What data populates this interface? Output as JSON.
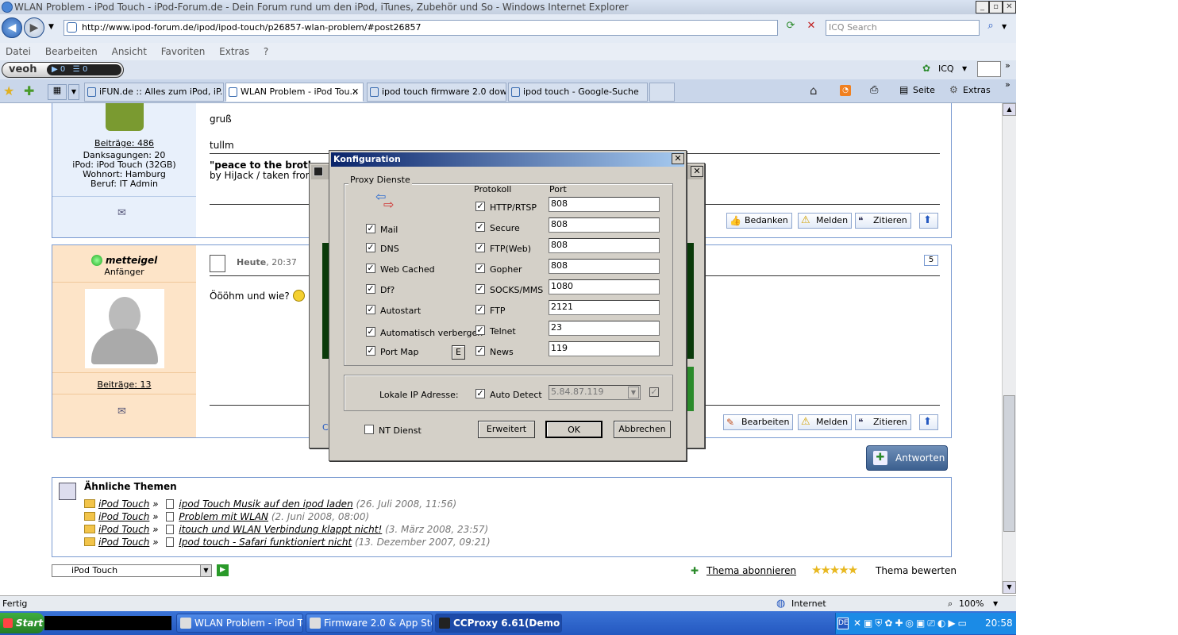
{
  "window": {
    "title": "WLAN Problem - iPod Touch - iPod-Forum.de - Dein Forum rund um den iPod, iTunes, Zubehör und So - Windows Internet Explorer"
  },
  "address": {
    "url": "http://www.ipod-forum.de/ipod/ipod-touch/p26857-wlan-problem/#post26857",
    "search_placeholder": "ICQ Search"
  },
  "menu": [
    "Datei",
    "Bearbeiten",
    "Ansicht",
    "Favoriten",
    "Extras",
    "?"
  ],
  "toolbar": {
    "veoh": "veoh",
    "icq": "ICQ",
    "counter1": "0",
    "counter2": "0"
  },
  "tabs": [
    "iFUN.de :: Alles zum iPod, iP...",
    "WLAN Problem - iPod Tou...",
    "ipod touch firmware 2.0 dow...",
    "ipod touch - Google-Suche"
  ],
  "cmdbar": {
    "seite": "Seite",
    "extras": "Extras"
  },
  "post1": {
    "beitraege": "Beiträge: 486",
    "danksagungen": "Danksagungen: 20",
    "ipod": "iPod: iPod Touch (32GB)",
    "wohnort": "Wohnort: Hamburg",
    "beruf": "Beruf: IT Admin",
    "line1": "gruß",
    "line2": "tullm",
    "quote": "\"peace to the broth",
    "quote2": "by HiJack / taken fron",
    "btn_thanks": "Bedanken",
    "btn_report": "Melden",
    "btn_quote": "Zitieren"
  },
  "post2": {
    "user": "metteigel",
    "rank": "Anfänger",
    "beitraege": "Beiträge: 13",
    "date": "Heute",
    "time": ", 20:37",
    "number": "5",
    "text": "Öööhm und wie?",
    "btn_edit": "Bearbeiten",
    "btn_report": "Melden",
    "btn_quote": "Zitieren"
  },
  "reply_btn": "Antworten",
  "similar": {
    "title": "Ähnliche Themen",
    "rows": [
      {
        "cat": "iPod Touch",
        "topic": "ipod Touch Musik auf den ipod laden",
        "date": "(26. Juli 2008, 11:56)"
      },
      {
        "cat": "iPod Touch",
        "topic": "Problem mit WLAN",
        "date": "(2. Juni 2008, 08:00)"
      },
      {
        "cat": "iPod Touch",
        "topic": "itouch und WLAN Verbindung klappt nicht!",
        "date": "(3. März 2008, 23:57)"
      },
      {
        "cat": "iPod Touch",
        "topic": "Ipod touch - Safari funktioniert nicht",
        "date": "(13. Dezember 2007, 09:21)"
      }
    ]
  },
  "footer": {
    "select": "iPod Touch",
    "subscribe": "Thema abonnieren",
    "rate": "Thema bewerten"
  },
  "status": {
    "text": "Fertig",
    "zone": "Internet",
    "zoom": "100%"
  },
  "taskbar": {
    "start": "Start",
    "items": [
      "WLAN Problem - iPod To...",
      "Firmware 2.0 & App Stor...",
      "CCProxy 6.61(Demo v..."
    ],
    "clock": "20:58",
    "lang": "DE"
  },
  "dialog": {
    "title": "Konfiguration",
    "group": "Proxy Dienste",
    "protokoll": "Protokoll",
    "port": "Port",
    "left": [
      "Mail",
      "DNS",
      "Web Cached",
      "Df?",
      "Autostart",
      "Automatisch verbergen",
      "Port Map"
    ],
    "portmap_btn": "E",
    "protocols": [
      {
        "name": "HTTP/RTSP",
        "port": "808"
      },
      {
        "name": "Secure",
        "port": "808"
      },
      {
        "name": "FTP(Web)",
        "port": "808"
      },
      {
        "name": "Gopher",
        "port": "808"
      },
      {
        "name": "SOCKS/MMS",
        "port": "1080"
      },
      {
        "name": "FTP",
        "port": "2121"
      },
      {
        "name": "Telnet",
        "port": "23"
      },
      {
        "name": "News",
        "port": "119"
      }
    ],
    "ip_label": "Lokale IP Adresse:",
    "auto_detect": "Auto Detect",
    "ip_value": "5.84.87.119",
    "nt": "NT Dienst",
    "btn_adv": "Erweitert",
    "btn_ok": "OK",
    "btn_cancel": "Abbrechen",
    "check": "✓"
  },
  "bgdialog": {
    "label": "C"
  }
}
